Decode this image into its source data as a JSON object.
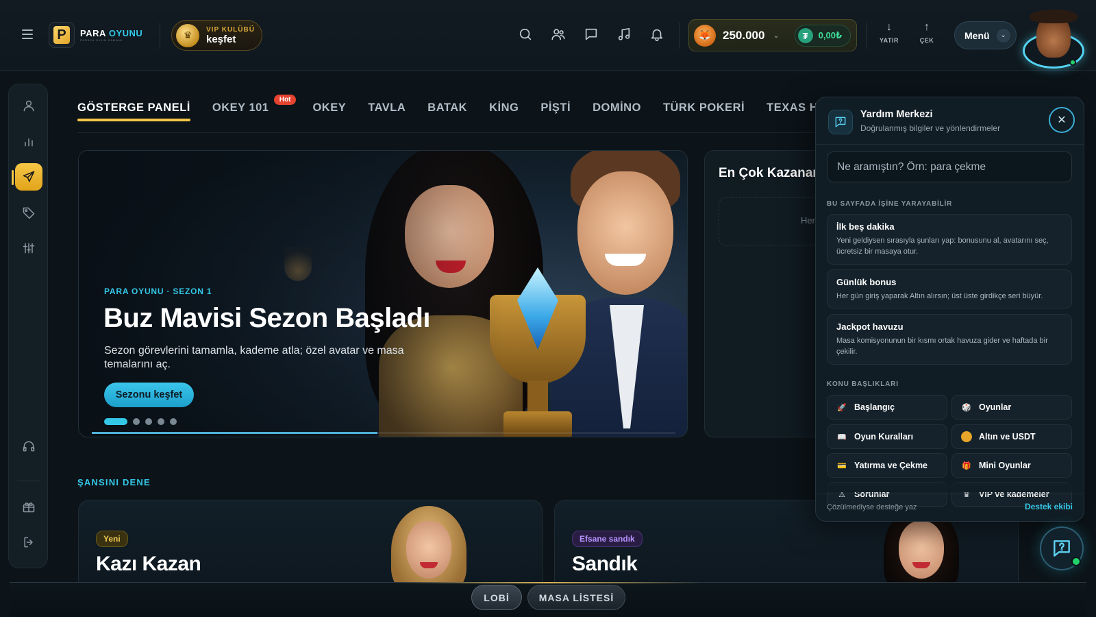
{
  "brand": {
    "name_part1": "PARA",
    "name_part2": "OYUNU",
    "tagline": "PARAYA OYUN ZAMANI",
    "logo_letter": "P"
  },
  "vip": {
    "top": "VIP KULÜBÜ",
    "bottom": "keşfet"
  },
  "header_icons": [
    "search-icon",
    "friends-icon",
    "chat-icon",
    "music-icon",
    "bell-icon"
  ],
  "wallet": {
    "coins": "250.000",
    "usdt": "0,00₺",
    "usdt_symbol": "₮"
  },
  "deposit": {
    "arrow": "↓",
    "label": "YATIR"
  },
  "withdraw": {
    "arrow": "↑",
    "label": "ÇEK"
  },
  "menu": {
    "label": "Menü"
  },
  "tabs": [
    {
      "label": "GÖSTERGE PANELİ",
      "active": true
    },
    {
      "label": "OKEY 101",
      "badge": "Hot"
    },
    {
      "label": "OKEY"
    },
    {
      "label": "TAVLA"
    },
    {
      "label": "BATAK"
    },
    {
      "label": "KİNG"
    },
    {
      "label": "PİŞTİ"
    },
    {
      "label": "DOMİNO"
    },
    {
      "label": "TÜRK POKERİ"
    },
    {
      "label": "TEXAS HOLD'EM"
    }
  ],
  "hero": {
    "kicker": "PARA OYUNU · SEZON 1",
    "title": "Buz Mavisi Sezon Başladı",
    "description": "Sezon görevlerini tamamla, kademe atla; özel avatar ve masa temalarını aç.",
    "cta": "Sezonu keşfet",
    "slides": 5,
    "active_slide": 0,
    "progress": 0.49
  },
  "side_card": {
    "title": "En Çok Kazananlar",
    "placeholder": "Henüz"
  },
  "section": {
    "title": "ŞANSINI DENE"
  },
  "cards": [
    {
      "badge": "Yeni",
      "title": "Kazı Kazan",
      "badge_color": "#e9c24a"
    },
    {
      "badge": "Efsane sandık",
      "title": "Sandık",
      "badge_color": "#a478f0"
    }
  ],
  "bottom_nav": {
    "lobby": "LOBİ",
    "tables": "MASA LİSTESİ"
  },
  "help": {
    "title": "Yardım Merkezi",
    "subtitle": "Doğrulanmış bilgiler ve yönlendirmeler",
    "search_placeholder": "Ne aramıştın? Örn: para çekme",
    "tips_label": "BU SAYFADA İŞİNE YARAYABİLİR",
    "tips": [
      {
        "title": "İlk beş dakika",
        "desc": "Yeni geldiysen sırasıyla şunları yap: bonusunu al, avatarını seç, ücretsiz bir masaya otur."
      },
      {
        "title": "Günlük bonus",
        "desc": "Her gün giriş yaparak Altın alırsın; üst üste girdikçe seri büyür."
      },
      {
        "title": "Jackpot havuzu",
        "desc": "Masa komisyonunun bir kısmı ortak havuza gider ve haftada bir çekilir."
      }
    ],
    "topics_label": "KONU BAŞLIKLARI",
    "topics": [
      {
        "label": "Başlangıç",
        "icon": "rocket-icon"
      },
      {
        "label": "Oyunlar",
        "icon": "dice-icon"
      },
      {
        "label": "Oyun Kuralları",
        "icon": "book-icon"
      },
      {
        "label": "Altın ve USDT",
        "icon": "coin-icon"
      },
      {
        "label": "Yatırma ve Çekme",
        "icon": "card-icon"
      },
      {
        "label": "Mini Oyunlar",
        "icon": "gift-icon"
      },
      {
        "label": "Sorunlar",
        "icon": "warning-icon"
      },
      {
        "label": "VIP ve kademeler",
        "icon": "crown-icon"
      }
    ],
    "footer_left": "Çözülmediyse desteğe yaz",
    "footer_right": "Destek ekibi"
  }
}
